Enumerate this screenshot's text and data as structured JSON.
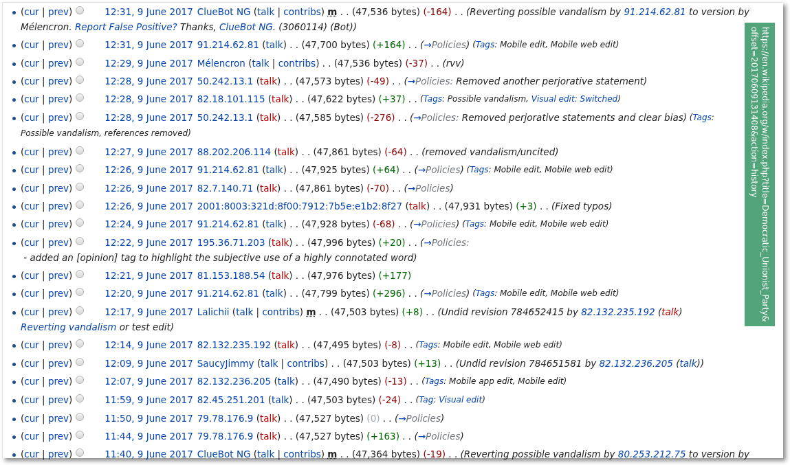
{
  "url_overlay": {
    "lines": [
      "https://en.wikipedia.org/w/index.php?title=Democratic_Unionist_Party&",
      "offset=20170609131408&action=history"
    ]
  },
  "revisions": [
    {
      "history": [
        {
          "kind": "text",
          "text": "("
        },
        {
          "kind": "link",
          "text": "cur"
        },
        {
          "kind": "text",
          "text": " | "
        },
        {
          "kind": "link",
          "text": "prev"
        },
        {
          "kind": "text",
          "text": ")"
        }
      ],
      "checked": false,
      "line": [
        {
          "kind": "date",
          "text": "12:31, 9 June 2017"
        },
        {
          "kind": "link",
          "text": "ClueBot NG"
        },
        {
          "kind": "text",
          "text": " ("
        },
        {
          "kind": "link",
          "text": "talk"
        },
        {
          "kind": "text",
          "text": " | "
        },
        {
          "kind": "link",
          "text": "contribs"
        },
        {
          "kind": "text",
          "text": ") "
        },
        {
          "kind": "minor",
          "text": "m"
        },
        {
          "kind": "text",
          "text": " . . (47,536 bytes) "
        },
        {
          "kind": "minus",
          "text": "(-164)"
        },
        {
          "kind": "text",
          "text": " . . "
        }
      ],
      "summary": [
        {
          "kind": "text",
          "text": "(Reverting possible vandalism by "
        },
        {
          "kind": "link",
          "text": "91.214.62.81"
        },
        {
          "kind": "text",
          "text": " to version by "
        },
        {
          "kind": "text",
          "text": "Mélencron. "
        },
        {
          "kind": "link",
          "text": "Report False Positive?"
        },
        {
          "kind": "text",
          "text": " Thanks, "
        },
        {
          "kind": "link",
          "text": "ClueBot NG"
        },
        {
          "kind": "text",
          "text": ". (3060114) (Bot))"
        }
      ]
    },
    {
      "history": [
        {
          "kind": "text",
          "text": "("
        },
        {
          "kind": "link",
          "text": "cur"
        },
        {
          "kind": "text",
          "text": " | "
        },
        {
          "kind": "link",
          "text": "prev"
        },
        {
          "kind": "text",
          "text": ")"
        }
      ],
      "checked": false,
      "line": [
        {
          "kind": "date",
          "text": "12:31, 9 June 2017"
        },
        {
          "kind": "link",
          "text": "91.214.62.81"
        },
        {
          "kind": "text",
          "text": " ("
        },
        {
          "kind": "link",
          "text": "talk"
        },
        {
          "kind": "text",
          "text": ") . . (47,700 bytes) "
        },
        {
          "kind": "plus",
          "text": "(+164)"
        },
        {
          "kind": "text",
          "text": " . . "
        }
      ],
      "summary": [
        {
          "kind": "text",
          "text": "("
        },
        {
          "kind": "link",
          "text": "→"
        },
        {
          "kind": "section",
          "text": "Policies"
        },
        {
          "kind": "text",
          "text": ")"
        }
      ],
      "tags": [
        {
          "kind": "text",
          "text": " ("
        },
        {
          "kind": "link",
          "text": "Tags"
        },
        {
          "kind": "text",
          "text": ": Mobile edit, Mobile web edit)"
        }
      ]
    },
    {
      "history": [
        {
          "kind": "text",
          "text": "("
        },
        {
          "kind": "link",
          "text": "cur"
        },
        {
          "kind": "text",
          "text": " | "
        },
        {
          "kind": "link",
          "text": "prev"
        },
        {
          "kind": "text",
          "text": ")"
        }
      ],
      "checked": false,
      "line": [
        {
          "kind": "date",
          "text": "12:29, 9 June 2017"
        },
        {
          "kind": "link",
          "text": "Mélencron"
        },
        {
          "kind": "text",
          "text": " ("
        },
        {
          "kind": "link",
          "text": "talk"
        },
        {
          "kind": "text",
          "text": " | "
        },
        {
          "kind": "link",
          "text": "contribs"
        },
        {
          "kind": "text",
          "text": ") . . (47,536 bytes) "
        },
        {
          "kind": "minus",
          "text": "(-37)"
        },
        {
          "kind": "text",
          "text": " . . "
        }
      ],
      "summary": [
        {
          "kind": "text",
          "text": "(rvv)"
        }
      ]
    },
    {
      "history": [
        {
          "kind": "text",
          "text": "("
        },
        {
          "kind": "link",
          "text": "cur"
        },
        {
          "kind": "text",
          "text": " | "
        },
        {
          "kind": "link",
          "text": "prev"
        },
        {
          "kind": "text",
          "text": ")"
        }
      ],
      "checked": false,
      "line": [
        {
          "kind": "date",
          "text": "12:28, 9 June 2017"
        },
        {
          "kind": "link",
          "text": "50.242.13.1"
        },
        {
          "kind": "text",
          "text": " ("
        },
        {
          "kind": "missing",
          "text": "talk"
        },
        {
          "kind": "text",
          "text": ") . . (47,573 bytes) "
        },
        {
          "kind": "minus",
          "text": "(-49)"
        },
        {
          "kind": "text",
          "text": " . . "
        }
      ],
      "summary": [
        {
          "kind": "text",
          "text": "("
        },
        {
          "kind": "link",
          "text": "→"
        },
        {
          "kind": "section",
          "text": "Policies:"
        },
        {
          "kind": "text",
          "text": " Removed another perjorative statement)"
        }
      ]
    },
    {
      "history": [
        {
          "kind": "text",
          "text": "("
        },
        {
          "kind": "link",
          "text": "cur"
        },
        {
          "kind": "text",
          "text": " | "
        },
        {
          "kind": "link",
          "text": "prev"
        },
        {
          "kind": "text",
          "text": ")"
        }
      ],
      "checked": false,
      "line": [
        {
          "kind": "date",
          "text": "12:28, 9 June 2017"
        },
        {
          "kind": "link",
          "text": "82.18.101.115"
        },
        {
          "kind": "text",
          "text": " ("
        },
        {
          "kind": "missing",
          "text": "talk"
        },
        {
          "kind": "text",
          "text": ") . . (47,622 bytes) "
        },
        {
          "kind": "plus",
          "text": "(+37)"
        },
        {
          "kind": "text",
          "text": " . . "
        }
      ],
      "tags": [
        {
          "kind": "text",
          "text": "("
        },
        {
          "kind": "link",
          "text": "Tags"
        },
        {
          "kind": "text",
          "text": ": Possible vandalism, "
        },
        {
          "kind": "link",
          "text": "Visual edit: Switched"
        },
        {
          "kind": "text",
          "text": ")"
        }
      ]
    },
    {
      "history": [
        {
          "kind": "text",
          "text": "("
        },
        {
          "kind": "link",
          "text": "cur"
        },
        {
          "kind": "text",
          "text": " | "
        },
        {
          "kind": "link",
          "text": "prev"
        },
        {
          "kind": "text",
          "text": ")"
        }
      ],
      "checked": false,
      "line": [
        {
          "kind": "date",
          "text": "12:28, 9 June 2017"
        },
        {
          "kind": "link",
          "text": "50.242.13.1"
        },
        {
          "kind": "text",
          "text": " ("
        },
        {
          "kind": "missing",
          "text": "talk"
        },
        {
          "kind": "text",
          "text": ") . . (47,585 bytes) "
        },
        {
          "kind": "minus",
          "text": "(-276)"
        },
        {
          "kind": "text",
          "text": " . . "
        }
      ],
      "summary": [
        {
          "kind": "text",
          "text": "("
        },
        {
          "kind": "link",
          "text": "→"
        },
        {
          "kind": "section",
          "text": "Policies:"
        },
        {
          "kind": "text",
          "text": " Removed perjorative statements and clear bias)"
        }
      ],
      "tags": [
        {
          "kind": "text",
          "text": " ("
        },
        {
          "kind": "link",
          "text": "Tags"
        },
        {
          "kind": "text",
          "text": ": "
        },
        {
          "kind": "text",
          "text": "Possible vandalism, references removed)"
        }
      ]
    },
    {
      "history": [
        {
          "kind": "text",
          "text": "("
        },
        {
          "kind": "link",
          "text": "cur"
        },
        {
          "kind": "text",
          "text": " | "
        },
        {
          "kind": "link",
          "text": "prev"
        },
        {
          "kind": "text",
          "text": ")"
        }
      ],
      "checked": false,
      "line": [
        {
          "kind": "date",
          "text": "12:27, 9 June 2017"
        },
        {
          "kind": "link",
          "text": "88.202.206.114"
        },
        {
          "kind": "text",
          "text": " ("
        },
        {
          "kind": "missing",
          "text": "talk"
        },
        {
          "kind": "text",
          "text": ") . . (47,861 bytes) "
        },
        {
          "kind": "minus",
          "text": "(-64)"
        },
        {
          "kind": "text",
          "text": " . . "
        }
      ],
      "summary": [
        {
          "kind": "text",
          "text": "(removed vandalism/uncited)"
        }
      ]
    },
    {
      "history": [
        {
          "kind": "text",
          "text": "("
        },
        {
          "kind": "link",
          "text": "cur"
        },
        {
          "kind": "text",
          "text": " | "
        },
        {
          "kind": "link",
          "text": "prev"
        },
        {
          "kind": "text",
          "text": ")"
        }
      ],
      "checked": false,
      "line": [
        {
          "kind": "date",
          "text": "12:26, 9 June 2017"
        },
        {
          "kind": "link",
          "text": "91.214.62.81"
        },
        {
          "kind": "text",
          "text": " ("
        },
        {
          "kind": "link",
          "text": "talk"
        },
        {
          "kind": "text",
          "text": ") . . (47,925 bytes) "
        },
        {
          "kind": "plus",
          "text": "(+64)"
        },
        {
          "kind": "text",
          "text": " . . "
        }
      ],
      "summary": [
        {
          "kind": "text",
          "text": "("
        },
        {
          "kind": "link",
          "text": "→"
        },
        {
          "kind": "section",
          "text": "Policies"
        },
        {
          "kind": "text",
          "text": ")"
        }
      ],
      "tags": [
        {
          "kind": "text",
          "text": " ("
        },
        {
          "kind": "link",
          "text": "Tags"
        },
        {
          "kind": "text",
          "text": ": Mobile edit, Mobile web edit)"
        }
      ]
    },
    {
      "history": [
        {
          "kind": "text",
          "text": "("
        },
        {
          "kind": "link",
          "text": "cur"
        },
        {
          "kind": "text",
          "text": " | "
        },
        {
          "kind": "link",
          "text": "prev"
        },
        {
          "kind": "text",
          "text": ")"
        }
      ],
      "checked": false,
      "line": [
        {
          "kind": "date",
          "text": "12:26, 9 June 2017"
        },
        {
          "kind": "link",
          "text": "82.7.140.71"
        },
        {
          "kind": "text",
          "text": " ("
        },
        {
          "kind": "missing",
          "text": "talk"
        },
        {
          "kind": "text",
          "text": ") . . (47,861 bytes) "
        },
        {
          "kind": "minus",
          "text": "(-70)"
        },
        {
          "kind": "text",
          "text": " . . "
        }
      ],
      "summary": [
        {
          "kind": "text",
          "text": "("
        },
        {
          "kind": "link",
          "text": "→"
        },
        {
          "kind": "section",
          "text": "Policies"
        },
        {
          "kind": "text",
          "text": ")"
        }
      ]
    },
    {
      "history": [
        {
          "kind": "text",
          "text": "("
        },
        {
          "kind": "link",
          "text": "cur"
        },
        {
          "kind": "text",
          "text": " | "
        },
        {
          "kind": "link",
          "text": "prev"
        },
        {
          "kind": "text",
          "text": ")"
        }
      ],
      "checked": false,
      "line": [
        {
          "kind": "date",
          "text": "12:26, 9 June 2017"
        },
        {
          "kind": "link",
          "text": "2001:8003:321d:8f00:7912:7b5e:e1b2:8f27"
        },
        {
          "kind": "text",
          "text": " ("
        },
        {
          "kind": "missing",
          "text": "talk"
        },
        {
          "kind": "text",
          "text": ") . . (47,931 bytes) "
        },
        {
          "kind": "plus",
          "text": "(+3)"
        },
        {
          "kind": "text",
          "text": " . . "
        }
      ],
      "summary": [
        {
          "kind": "text",
          "text": "(Fixed typos)"
        }
      ]
    },
    {
      "history": [
        {
          "kind": "text",
          "text": "("
        },
        {
          "kind": "link",
          "text": "cur"
        },
        {
          "kind": "text",
          "text": " | "
        },
        {
          "kind": "link",
          "text": "prev"
        },
        {
          "kind": "text",
          "text": ")"
        }
      ],
      "checked": false,
      "line": [
        {
          "kind": "date",
          "text": "12:24, 9 June 2017"
        },
        {
          "kind": "link",
          "text": "91.214.62.81"
        },
        {
          "kind": "text",
          "text": " ("
        },
        {
          "kind": "link",
          "text": "talk"
        },
        {
          "kind": "text",
          "text": ") . . (47,928 bytes) "
        },
        {
          "kind": "minus",
          "text": "(-68)"
        },
        {
          "kind": "text",
          "text": " . . "
        }
      ],
      "summary": [
        {
          "kind": "text",
          "text": "("
        },
        {
          "kind": "link",
          "text": "→"
        },
        {
          "kind": "section",
          "text": "Policies"
        },
        {
          "kind": "text",
          "text": ")"
        }
      ],
      "tags": [
        {
          "kind": "text",
          "text": " ("
        },
        {
          "kind": "link",
          "text": "Tags"
        },
        {
          "kind": "text",
          "text": ": Mobile edit, Mobile web edit)"
        }
      ]
    },
    {
      "history": [
        {
          "kind": "text",
          "text": "("
        },
        {
          "kind": "link",
          "text": "cur"
        },
        {
          "kind": "text",
          "text": " | "
        },
        {
          "kind": "link",
          "text": "prev"
        },
        {
          "kind": "text",
          "text": ")"
        }
      ],
      "checked": false,
      "line": [
        {
          "kind": "date",
          "text": "12:22, 9 June 2017"
        },
        {
          "kind": "link",
          "text": "195.36.71.203"
        },
        {
          "kind": "text",
          "text": " ("
        },
        {
          "kind": "missing",
          "text": "talk"
        },
        {
          "kind": "text",
          "text": ") . . (47,996 bytes) "
        },
        {
          "kind": "plus",
          "text": "(+20)"
        },
        {
          "kind": "text",
          "text": " . . "
        }
      ],
      "summary": [
        {
          "kind": "text",
          "text": "("
        },
        {
          "kind": "link",
          "text": "→"
        },
        {
          "kind": "section",
          "text": "Policies:"
        },
        {
          "kind": "text",
          "text": " - added an [opinion] tag to highlight the subjective use of "
        },
        {
          "kind": "text",
          "text": "a highly connotated word)"
        }
      ]
    },
    {
      "history": [
        {
          "kind": "text",
          "text": "("
        },
        {
          "kind": "link",
          "text": "cur"
        },
        {
          "kind": "text",
          "text": " | "
        },
        {
          "kind": "link",
          "text": "prev"
        },
        {
          "kind": "text",
          "text": ")"
        }
      ],
      "checked": false,
      "line": [
        {
          "kind": "date",
          "text": "12:21, 9 June 2017"
        },
        {
          "kind": "link",
          "text": "81.153.188.54"
        },
        {
          "kind": "text",
          "text": " ("
        },
        {
          "kind": "missing",
          "text": "talk"
        },
        {
          "kind": "text",
          "text": ") . . (47,976 bytes) "
        },
        {
          "kind": "plus",
          "text": "(+177)"
        }
      ]
    },
    {
      "history": [
        {
          "kind": "text",
          "text": "("
        },
        {
          "kind": "link",
          "text": "cur"
        },
        {
          "kind": "text",
          "text": " | "
        },
        {
          "kind": "link",
          "text": "prev"
        },
        {
          "kind": "text",
          "text": ")"
        }
      ],
      "checked": false,
      "line": [
        {
          "kind": "date",
          "text": "12:20, 9 June 2017"
        },
        {
          "kind": "link",
          "text": "91.214.62.81"
        },
        {
          "kind": "text",
          "text": " ("
        },
        {
          "kind": "link",
          "text": "talk"
        },
        {
          "kind": "text",
          "text": ") . . (47,799 bytes) "
        },
        {
          "kind": "plus",
          "text": "(+296)"
        },
        {
          "kind": "text",
          "text": " . . "
        }
      ],
      "summary": [
        {
          "kind": "text",
          "text": "("
        },
        {
          "kind": "link",
          "text": "→"
        },
        {
          "kind": "section",
          "text": "Policies"
        },
        {
          "kind": "text",
          "text": ")"
        }
      ],
      "tags": [
        {
          "kind": "text",
          "text": " ("
        },
        {
          "kind": "link",
          "text": "Tags"
        },
        {
          "kind": "text",
          "text": ": Mobile edit, Mobile web edit)"
        }
      ]
    },
    {
      "history": [
        {
          "kind": "text",
          "text": "("
        },
        {
          "kind": "link",
          "text": "cur"
        },
        {
          "kind": "text",
          "text": " | "
        },
        {
          "kind": "link",
          "text": "prev"
        },
        {
          "kind": "text",
          "text": ")"
        }
      ],
      "checked": false,
      "line": [
        {
          "kind": "date",
          "text": "12:17, 9 June 2017"
        },
        {
          "kind": "link",
          "text": "Lalichii"
        },
        {
          "kind": "text",
          "text": " ("
        },
        {
          "kind": "link",
          "text": "talk"
        },
        {
          "kind": "text",
          "text": " | "
        },
        {
          "kind": "link",
          "text": "contribs"
        },
        {
          "kind": "text",
          "text": ") "
        },
        {
          "kind": "minor",
          "text": "m"
        },
        {
          "kind": "text",
          "text": " . . (47,503 bytes) "
        },
        {
          "kind": "plus",
          "text": "(+8)"
        },
        {
          "kind": "text",
          "text": " . . "
        }
      ],
      "summary": [
        {
          "kind": "text",
          "text": "(Undid revision 784652415 by "
        },
        {
          "kind": "link",
          "text": "82.132.235.192"
        },
        {
          "kind": "text",
          "text": " ("
        },
        {
          "kind": "missing",
          "text": "talk"
        },
        {
          "kind": "text",
          "text": ") "
        },
        {
          "kind": "link",
          "text": "Reverting vandalism"
        },
        {
          "kind": "text",
          "text": " or test edit)"
        }
      ]
    },
    {
      "history": [
        {
          "kind": "text",
          "text": "("
        },
        {
          "kind": "link",
          "text": "cur"
        },
        {
          "kind": "text",
          "text": " | "
        },
        {
          "kind": "link",
          "text": "prev"
        },
        {
          "kind": "text",
          "text": ")"
        }
      ],
      "checked": false,
      "line": [
        {
          "kind": "date",
          "text": "12:14, 9 June 2017"
        },
        {
          "kind": "link",
          "text": "82.132.235.192"
        },
        {
          "kind": "text",
          "text": " ("
        },
        {
          "kind": "missing",
          "text": "talk"
        },
        {
          "kind": "text",
          "text": ") . . (47,495 bytes) "
        },
        {
          "kind": "minus",
          "text": "(-8)"
        },
        {
          "kind": "text",
          "text": " . . "
        }
      ],
      "tags": [
        {
          "kind": "text",
          "text": "("
        },
        {
          "kind": "link",
          "text": "Tags"
        },
        {
          "kind": "text",
          "text": ": Mobile edit, Mobile web edit)"
        }
      ]
    },
    {
      "history": [
        {
          "kind": "text",
          "text": "("
        },
        {
          "kind": "link",
          "text": "cur"
        },
        {
          "kind": "text",
          "text": " | "
        },
        {
          "kind": "link",
          "text": "prev"
        },
        {
          "kind": "text",
          "text": ")"
        }
      ],
      "checked": false,
      "line": [
        {
          "kind": "date",
          "text": "12:09, 9 June 2017"
        },
        {
          "kind": "link",
          "text": "SaucyJimmy"
        },
        {
          "kind": "text",
          "text": " ("
        },
        {
          "kind": "link",
          "text": "talk"
        },
        {
          "kind": "text",
          "text": " | "
        },
        {
          "kind": "link",
          "text": "contribs"
        },
        {
          "kind": "text",
          "text": ") . . (47,503 bytes) "
        },
        {
          "kind": "plus",
          "text": "(+13)"
        },
        {
          "kind": "text",
          "text": " . . "
        }
      ],
      "summary": [
        {
          "kind": "text",
          "text": "(Undid revision 784651581 by "
        },
        {
          "kind": "link",
          "text": "82.132.236.205"
        },
        {
          "kind": "text",
          "text": " ("
        },
        {
          "kind": "link",
          "text": "talk"
        },
        {
          "kind": "text",
          "text": "))"
        }
      ]
    },
    {
      "history": [
        {
          "kind": "text",
          "text": "("
        },
        {
          "kind": "link",
          "text": "cur"
        },
        {
          "kind": "text",
          "text": " | "
        },
        {
          "kind": "link",
          "text": "prev"
        },
        {
          "kind": "text",
          "text": ")"
        }
      ],
      "checked": false,
      "line": [
        {
          "kind": "date",
          "text": "12:07, 9 June 2017"
        },
        {
          "kind": "link",
          "text": "82.132.236.205"
        },
        {
          "kind": "text",
          "text": " ("
        },
        {
          "kind": "link",
          "text": "talk"
        },
        {
          "kind": "text",
          "text": ") . . (47,490 bytes) "
        },
        {
          "kind": "minus",
          "text": "(-13)"
        },
        {
          "kind": "text",
          "text": " . . "
        }
      ],
      "tags": [
        {
          "kind": "text",
          "text": "("
        },
        {
          "kind": "link",
          "text": "Tags"
        },
        {
          "kind": "text",
          "text": ": Mobile app edit, Mobile edit)"
        }
      ]
    },
    {
      "history": [
        {
          "kind": "text",
          "text": "("
        },
        {
          "kind": "link",
          "text": "cur"
        },
        {
          "kind": "text",
          "text": " | "
        },
        {
          "kind": "link",
          "text": "prev"
        },
        {
          "kind": "text",
          "text": ")"
        }
      ],
      "checked": false,
      "line": [
        {
          "kind": "date",
          "text": "11:59, 9 June 2017"
        },
        {
          "kind": "link",
          "text": "82.45.251.201"
        },
        {
          "kind": "text",
          "text": " ("
        },
        {
          "kind": "link",
          "text": "talk"
        },
        {
          "kind": "text",
          "text": ") . . (47,503 bytes) "
        },
        {
          "kind": "minus",
          "text": "(-24)"
        },
        {
          "kind": "text",
          "text": " . . "
        }
      ],
      "tags": [
        {
          "kind": "text",
          "text": "("
        },
        {
          "kind": "link",
          "text": "Tag"
        },
        {
          "kind": "text",
          "text": ": "
        },
        {
          "kind": "link",
          "text": "Visual edit"
        },
        {
          "kind": "text",
          "text": ")"
        }
      ]
    },
    {
      "history": [
        {
          "kind": "text",
          "text": "("
        },
        {
          "kind": "link",
          "text": "cur"
        },
        {
          "kind": "text",
          "text": " | "
        },
        {
          "kind": "link",
          "text": "prev"
        },
        {
          "kind": "text",
          "text": ")"
        }
      ],
      "checked": false,
      "line": [
        {
          "kind": "date",
          "text": "11:50, 9 June 2017"
        },
        {
          "kind": "link",
          "text": "79.78.176.9"
        },
        {
          "kind": "text",
          "text": " ("
        },
        {
          "kind": "missing",
          "text": "talk"
        },
        {
          "kind": "text",
          "text": ") . . (47,527 bytes) "
        },
        {
          "kind": "zero",
          "text": "(0)"
        },
        {
          "kind": "text",
          "text": " . . "
        }
      ],
      "summary": [
        {
          "kind": "text",
          "text": "("
        },
        {
          "kind": "link",
          "text": "→"
        },
        {
          "kind": "section",
          "text": "Policies"
        },
        {
          "kind": "text",
          "text": ")"
        }
      ]
    },
    {
      "history": [
        {
          "kind": "text",
          "text": "("
        },
        {
          "kind": "link",
          "text": "cur"
        },
        {
          "kind": "text",
          "text": " | "
        },
        {
          "kind": "link",
          "text": "prev"
        },
        {
          "kind": "text",
          "text": ")"
        }
      ],
      "checked": false,
      "line": [
        {
          "kind": "date",
          "text": "11:44, 9 June 2017"
        },
        {
          "kind": "link",
          "text": "79.78.176.9"
        },
        {
          "kind": "text",
          "text": " ("
        },
        {
          "kind": "missing",
          "text": "talk"
        },
        {
          "kind": "text",
          "text": ") . . (47,527 bytes) "
        },
        {
          "kind": "plus",
          "text": "(+163)"
        },
        {
          "kind": "text",
          "text": " . . "
        }
      ],
      "summary": [
        {
          "kind": "text",
          "text": "("
        },
        {
          "kind": "link",
          "text": "→"
        },
        {
          "kind": "section",
          "text": "Policies"
        },
        {
          "kind": "text",
          "text": ")"
        }
      ]
    },
    {
      "history": [
        {
          "kind": "text",
          "text": "("
        },
        {
          "kind": "link",
          "text": "cur"
        },
        {
          "kind": "text",
          "text": " | "
        },
        {
          "kind": "link",
          "text": "prev"
        },
        {
          "kind": "text",
          "text": ")"
        }
      ],
      "checked": false,
      "line": [
        {
          "kind": "date",
          "text": "11:40, 9 June 2017"
        },
        {
          "kind": "link",
          "text": "ClueBot NG"
        },
        {
          "kind": "text",
          "text": " ("
        },
        {
          "kind": "link",
          "text": "talk"
        },
        {
          "kind": "text",
          "text": " | "
        },
        {
          "kind": "link",
          "text": "contribs"
        },
        {
          "kind": "text",
          "text": ") "
        },
        {
          "kind": "minor",
          "text": "m"
        },
        {
          "kind": "text",
          "text": " . . (47,364 bytes) "
        },
        {
          "kind": "minus",
          "text": "(-19)"
        },
        {
          "kind": "text",
          "text": " . . "
        }
      ],
      "summary": [
        {
          "kind": "text",
          "text": "(Reverting possible vandalism by "
        },
        {
          "kind": "link",
          "text": "80.253.212.75"
        },
        {
          "kind": "text",
          "text": " to version by"
        }
      ]
    }
  ]
}
